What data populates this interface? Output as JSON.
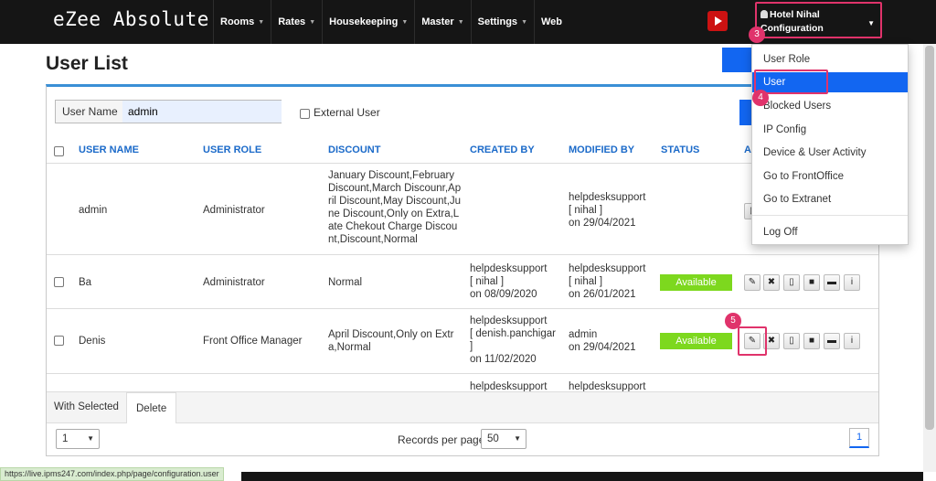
{
  "app": {
    "brand": "eZee Absolute"
  },
  "nav": [
    {
      "label": "Rooms",
      "caret": "▼"
    },
    {
      "label": "Rates",
      "caret": "▼"
    },
    {
      "label": "Housekeeping",
      "caret": "▼"
    },
    {
      "label": "Master",
      "caret": "▼"
    },
    {
      "label": "Settings",
      "caret": "▼"
    },
    {
      "label": "Web",
      "caret": ""
    }
  ],
  "account": {
    "line1": "Hotel Nihal",
    "line2": "Configuration"
  },
  "page": {
    "title": "User List"
  },
  "filter": {
    "label": "User Name",
    "value": "admin",
    "external_label": "External User"
  },
  "table": {
    "headers": [
      "USER NAME",
      "USER ROLE",
      "DISCOUNT",
      "CREATED BY",
      "MODIFIED BY",
      "STATUS",
      "A"
    ],
    "rows": [
      {
        "name": "admin",
        "role": "Administrator",
        "discount": [
          "January Discount,February",
          "Discount,March Discounr,Ap",
          "ril Discount,May Discount,Ju",
          "ne Discount,Only on Extra,L",
          "ate Chekout Charge Discou",
          "nt,Discount,Normal"
        ],
        "created": [],
        "modified": [
          "helpdesksupport",
          "[ nihal ]",
          "on 29/04/2021"
        ],
        "status": ""
      },
      {
        "name": "Ba",
        "role": "Administrator",
        "discount": [
          "Normal"
        ],
        "created": [
          "helpdesksupport",
          "[ nihal ]",
          "on 08/09/2020"
        ],
        "modified": [
          "helpdesksupport",
          "[ nihal ]",
          "on 26/01/2021"
        ],
        "status": "Available"
      },
      {
        "name": "Denis",
        "role": "Front Office Manager",
        "discount": [
          "April Discount,Only on Extr",
          "a,Normal"
        ],
        "created": [
          "helpdesksupport",
          "[ denish.panchigar",
          "]",
          "on 11/02/2020"
        ],
        "modified": [
          "admin",
          "on 29/04/2021"
        ],
        "status": "Available"
      },
      {
        "name": "",
        "role": "",
        "discount": [],
        "created": [
          "helpdesksupport"
        ],
        "modified": [
          "helpdesksupport"
        ],
        "status": ""
      }
    ]
  },
  "actions": {
    "edit": "✎",
    "delete": "✖",
    "mobile": "▯",
    "lock": "🔒",
    "comment": "▬",
    "info": "i"
  },
  "footer": {
    "with_selected": "With Selected",
    "delete": "Delete",
    "page_select": "1",
    "rpp_label": "Records per page",
    "rpp_value": "50",
    "current_page": "1"
  },
  "menu": {
    "items": [
      "User Role",
      "User",
      "Blocked Users",
      "IP Config",
      "Device & User Activity",
      "Go to FrontOffice",
      "Go to Extranet",
      "Log Off"
    ],
    "active_index": 1
  },
  "steps": [
    "3",
    "4",
    "5"
  ],
  "statusbar": {
    "url": "https://live.ipms247.com/index.php/page/configuration.user"
  },
  "colors": {
    "accent": "#1266f1",
    "highlight": "#e0336b",
    "available": "#7dd81e",
    "header_text": "#1b6ac9"
  }
}
